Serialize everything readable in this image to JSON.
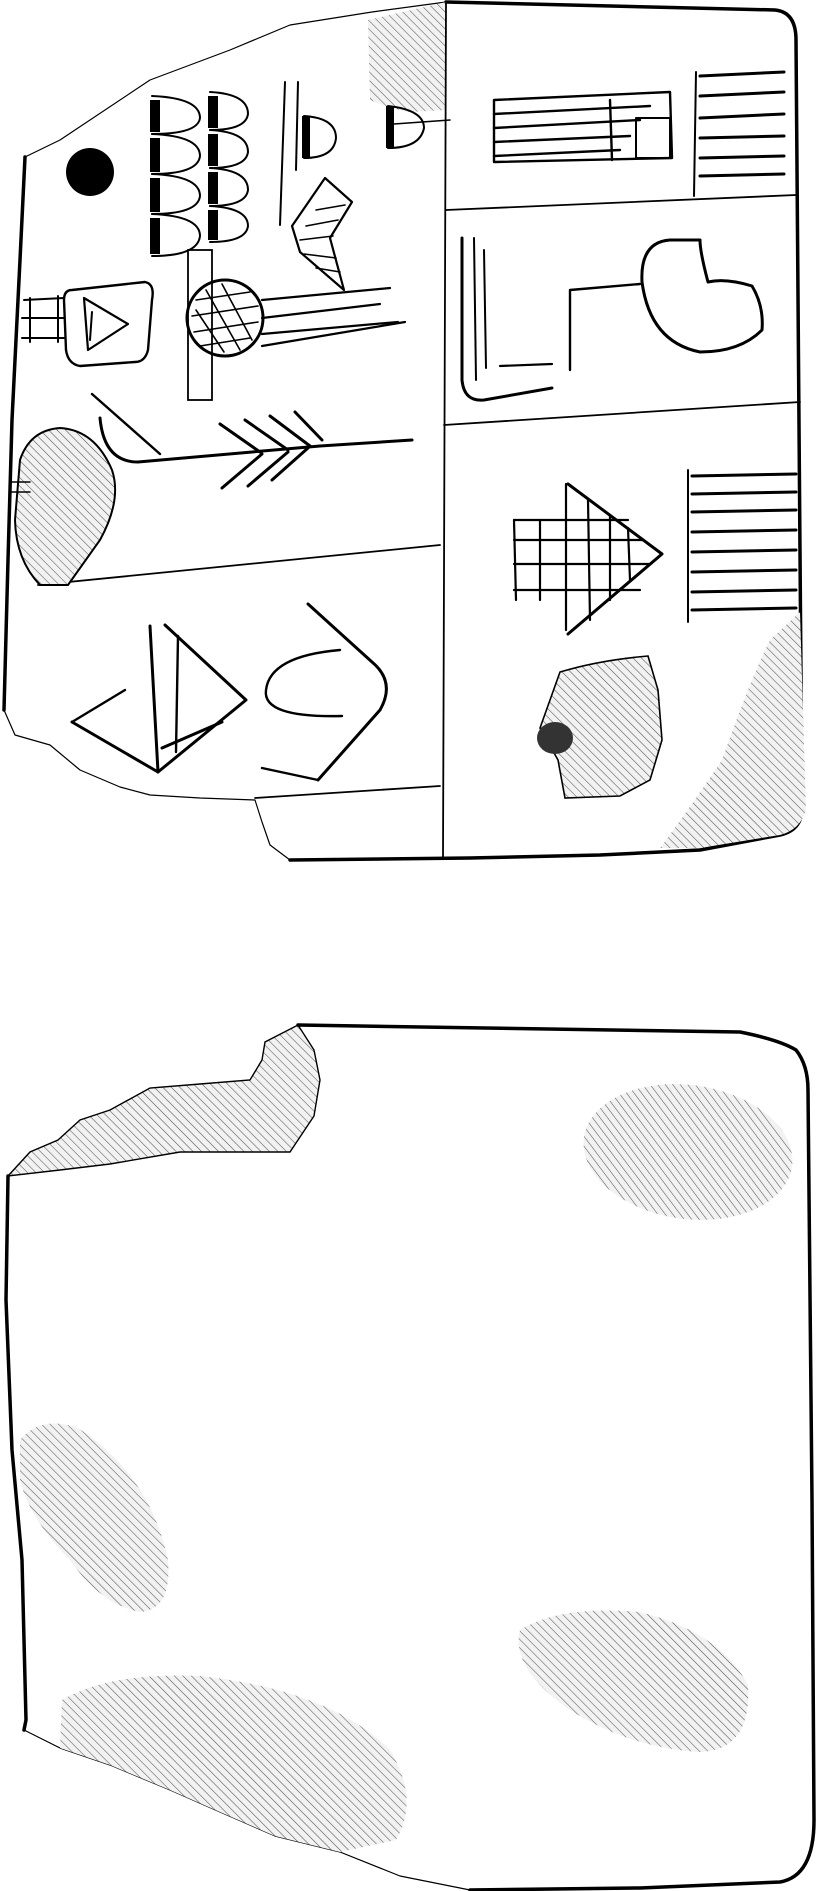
{
  "drawing": {
    "obverse": {
      "signs": [
        "numeral-marks",
        "triangle-sign",
        "grid-sign",
        "hook-sign",
        "v-sign"
      ]
    },
    "reverse": {
      "signs": []
    }
  },
  "colors": {
    "ink": "#000000",
    "hatch": "#555555",
    "background": "#ffffff",
    "fill-dark": "#333333"
  }
}
